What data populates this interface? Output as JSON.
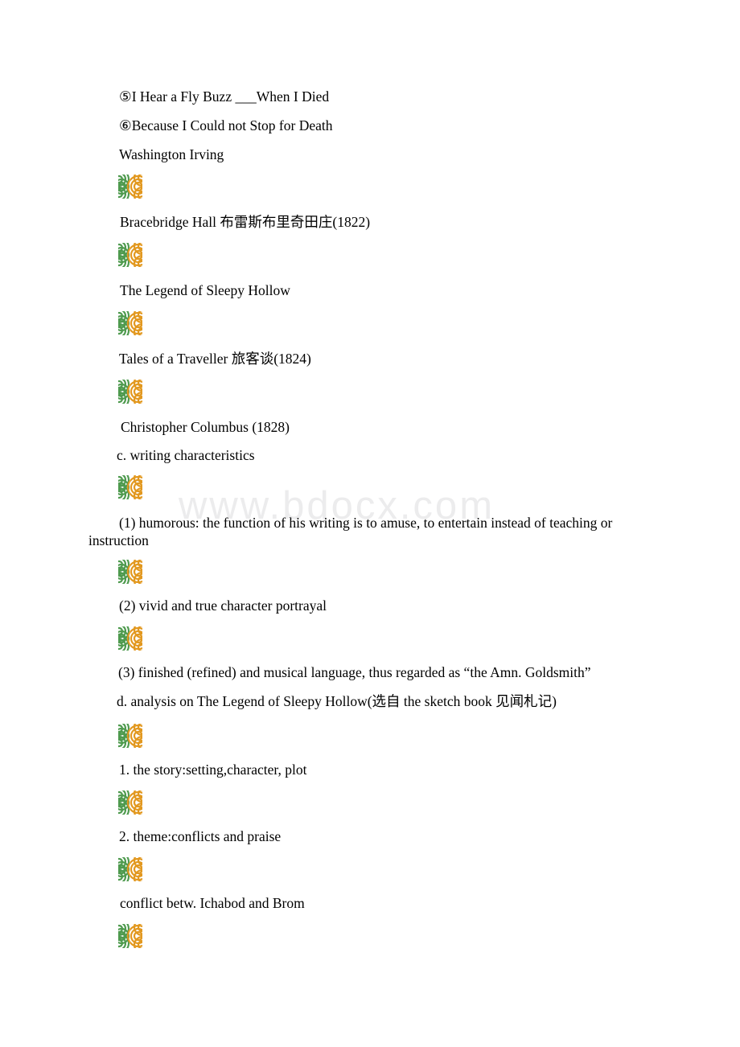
{
  "document": {
    "watermark": "www.bdocx.com",
    "page_background": "#ffffff",
    "text_color": "#000000",
    "watermark_color": "#ececed",
    "thumbnail_colors": {
      "green": "#4e9a4e",
      "orange": "#e2981f",
      "background": "#ffffff"
    }
  },
  "lines": {
    "poem_5": "⑤I Hear a Fly Buzz ___When I Died",
    "poem_6": "⑥Because I Could not Stop for Death",
    "author": "Washington Irving",
    "work_1": "Bracebridge Hall 布雷斯布里奇田庄(1822)",
    "work_2": "The Legend of Sleepy Hollow",
    "work_3": "Tales of a Traveller 旅客谈(1824)",
    "work_4": "Christopher Columbus (1828)",
    "section_c": "c. writing characteristics",
    "char_1": "(1) humorous: the function of his writing is to amuse, to entertain instead of teaching or instruction",
    "char_2": "(2) vivid and true character portrayal",
    "char_3": "(3) finished (refined) and musical language, thus regarded as “the Amn. Goldsmith”",
    "section_d": "d. analysis on The Legend of Sleepy Hollow(选自 the sketch book 见闻札记)",
    "analysis_1": "1. the story:setting,character, plot",
    "analysis_2": "2. theme:conflicts and praise",
    "analysis_3": "conflict betw. Ichabod and Brom"
  },
  "thumbnails": [
    {
      "name": "broken-image-thumbnail",
      "alt": ""
    },
    {
      "name": "broken-image-thumbnail",
      "alt": ""
    },
    {
      "name": "broken-image-thumbnail",
      "alt": ""
    },
    {
      "name": "broken-image-thumbnail",
      "alt": ""
    },
    {
      "name": "broken-image-thumbnail",
      "alt": ""
    },
    {
      "name": "broken-image-thumbnail",
      "alt": ""
    },
    {
      "name": "broken-image-thumbnail",
      "alt": ""
    },
    {
      "name": "broken-image-thumbnail",
      "alt": ""
    },
    {
      "name": "broken-image-thumbnail",
      "alt": ""
    },
    {
      "name": "broken-image-thumbnail",
      "alt": ""
    },
    {
      "name": "broken-image-thumbnail",
      "alt": ""
    },
    {
      "name": "broken-image-thumbnail",
      "alt": ""
    }
  ]
}
